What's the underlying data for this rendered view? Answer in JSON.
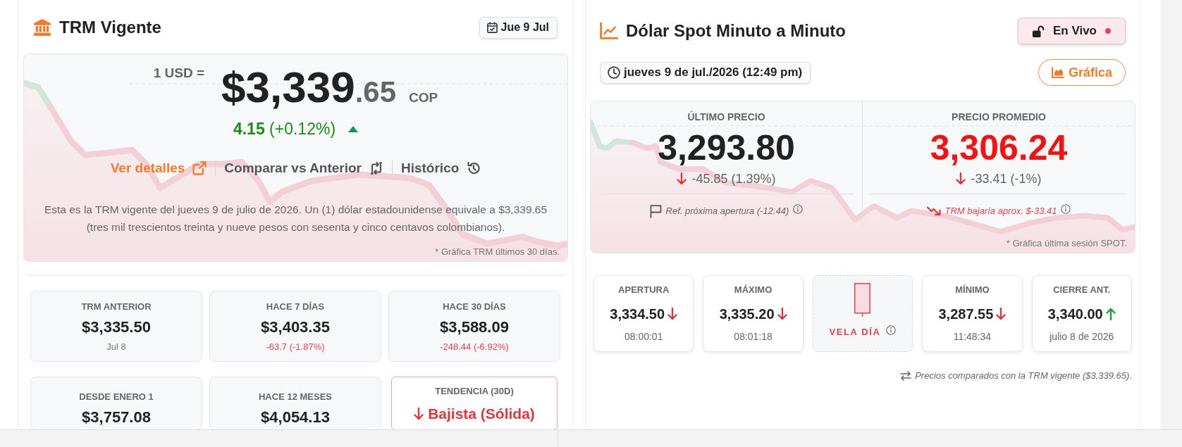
{
  "trm": {
    "title": "TRM Vigente",
    "date": "Jue 9 Jul",
    "hero": {
      "prefix": "1 USD =",
      "integer": "$3,339",
      "decimals": ".65",
      "currency": "COP",
      "change": "**4.15** (+0.12%)",
      "rising": true,
      "links": [
        {
          "label": "Ver detalles",
          "kind": "external",
          "highlighted": true
        },
        {
          "label": "Comparar vs Anterior",
          "kind": "compare",
          "highlighted": false
        },
        {
          "label": "Histórico",
          "kind": "history",
          "highlighted": false
        }
      ],
      "description": "Esta es la TRM vigente del jueves 9 de julio de 2026. Un (1) dólar estadounidense equivale a $3,339.65 (tres mil trescientos treinta y nueve pesos con sesenta y cinco centavos colombianos).",
      "chart_note": "* Gráfica TRM últimos 30 días."
    },
    "stats": [
      {
        "kind": "stat",
        "label": "TRM ANTERIOR",
        "value": "$3,335.50",
        "sub": "Jul 8",
        "negative": false
      },
      {
        "kind": "stat",
        "label": "HACE 7 DÍAS",
        "value": "$3,403.35",
        "sub": "-63.7 (-1.87%)",
        "negative": true
      },
      {
        "kind": "stat",
        "label": "HACE 30 DÍAS",
        "value": "$3,588.09",
        "sub": "-248.44 (-6.92%)",
        "negative": true
      },
      {
        "kind": "stat",
        "label": "DESDE ENERO 1",
        "value": "$3,757.08"
      },
      {
        "kind": "stat",
        "label": "HACE 12 MESES",
        "value": "$4,054.13"
      },
      {
        "kind": "trend",
        "label": "TENDENCIA (30D)",
        "value": "Bajista (Sólida)",
        "falling": true
      }
    ]
  },
  "spot": {
    "title": "Dólar Spot Minuto a Minuto",
    "live": {
      "label": "En Vivo",
      "on": true
    },
    "timestamp": "jueves 9 de jul./2026 (12:49 pm)",
    "chart_button": "Gráfica",
    "prices": [
      {
        "label": "ÚLTIMO PRECIO",
        "value": "3,293.80",
        "highlighted": false,
        "falling": true,
        "change": "-45.85 (1.39%)",
        "note": {
          "kind": "flag",
          "text": "Ref. próxima apertura (-12.44)"
        }
      },
      {
        "label": "PRECIO PROMEDIO",
        "value": "3,306.24",
        "highlighted": true,
        "falling": true,
        "change": "-33.41 (-1%)",
        "note": {
          "kind": "trend",
          "text": "TRM bajaría aprox. $-33.41"
        }
      }
    ],
    "chart_note": "* Gráfica última sesión SPOT.",
    "stats": [
      {
        "kind": "stat",
        "label": "APERTURA",
        "value": "3,334.50",
        "falling": true,
        "sub": "08:00:01"
      },
      {
        "kind": "stat",
        "label": "MÁXIMO",
        "value": "3,335.20",
        "falling": true,
        "sub": "08:01:18"
      },
      {
        "kind": "candle",
        "label": "VELA DÍA"
      },
      {
        "kind": "stat",
        "label": "MÍNIMO",
        "value": "3,287.55",
        "falling": true,
        "sub": "11:48:34"
      },
      {
        "kind": "stat",
        "label": "CIERRE ANT.",
        "value": "3,340.00",
        "falling": false,
        "sub": "julio 8 de 2026"
      }
    ],
    "footnote": "Precios comparados con la TRM vigente ($3,339.65)."
  }
}
